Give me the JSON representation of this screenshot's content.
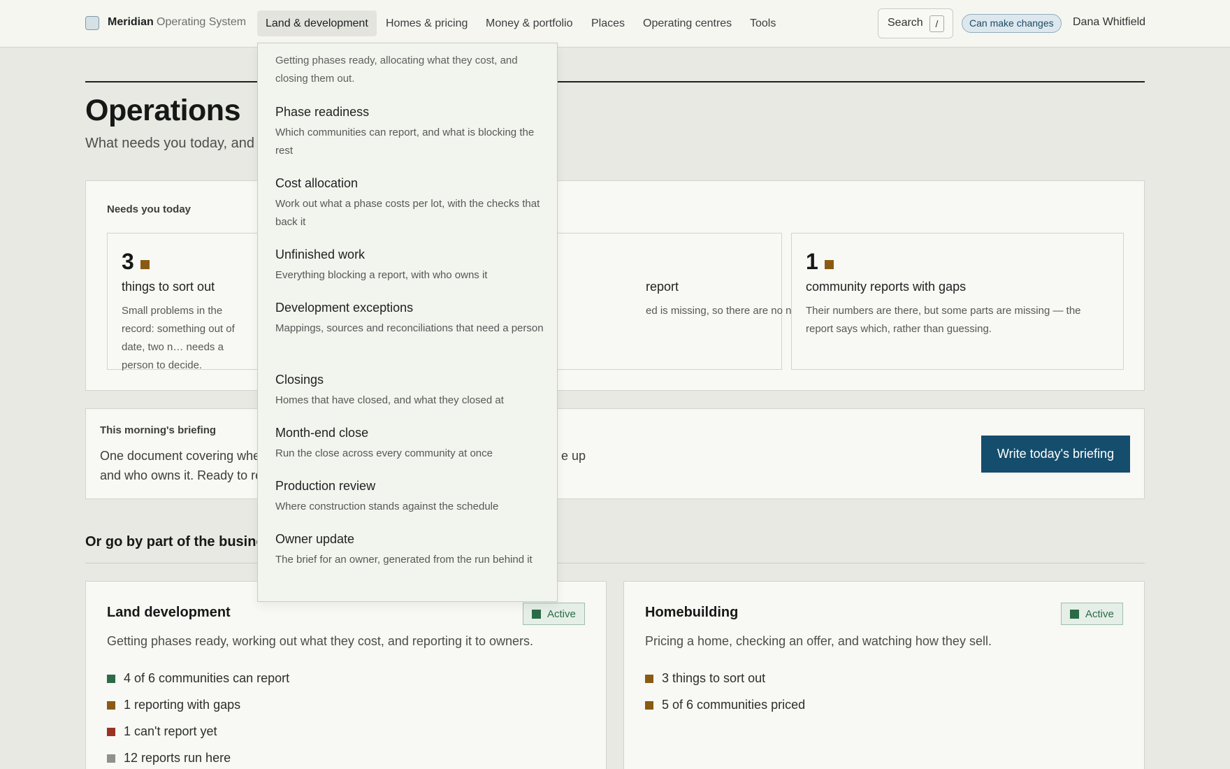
{
  "topbar": {
    "brand": "Meridian",
    "brand_sub": "Operating System",
    "nav": [
      {
        "label": "Land & development",
        "active": true
      },
      {
        "label": "Homes & pricing"
      },
      {
        "label": "Money & portfolio"
      },
      {
        "label": "Places"
      },
      {
        "label": "Operating centres"
      },
      {
        "label": "Tools"
      }
    ],
    "search_label": "Search",
    "search_shortcut": "/",
    "permission_badge": "Can make changes",
    "user_name": "Dana Whitfield"
  },
  "page": {
    "title": "Operations",
    "subtitle": "What needs you today, and"
  },
  "needs": {
    "label": "Needs you today",
    "cards": [
      {
        "count": "3",
        "title": "things to sort out",
        "desc": "Small problems in the record: something out of date, two n… needs a person to decide."
      },
      {
        "count": "",
        "title": "report",
        "desc": "ed is missing, so there are no numbers for"
      },
      {
        "count": "1",
        "title": "community reports with gaps",
        "desc": "Their numbers are there, but some parts are missing — the report says which, rather than guessing."
      }
    ]
  },
  "briefing": {
    "label": "This morning's briefing",
    "text_line1": "One document covering whe",
    "text_tail": "e up",
    "text_line2": "and who owns it. Ready to re",
    "button": "Write today's briefing"
  },
  "areas": {
    "section_title": "Or go by part of the busine",
    "cards": [
      {
        "title": "Land development",
        "desc": "Getting phases ready, working out what they cost, and reporting it to owners.",
        "status": "Active",
        "items": [
          {
            "text": "4 of 6 communities can report",
            "color": "#2c6b48"
          },
          {
            "text": "1 reporting with gaps",
            "color": "#8a5a14"
          },
          {
            "text": "1 can't report yet",
            "color": "#9a3324"
          },
          {
            "text": "12 reports run here",
            "color": "#8e918c"
          }
        ]
      },
      {
        "title": "Homebuilding",
        "desc": "Pricing a home, checking an offer, and watching how they sell.",
        "status": "Active",
        "items": [
          {
            "text": "3 things to sort out",
            "color": "#8a5a14"
          },
          {
            "text": "5 of 6 communities priced",
            "color": "#8a5a14"
          }
        ]
      }
    ]
  },
  "dropdown": {
    "intro": "Getting phases ready, allocating what they cost, and closing them out.",
    "items": [
      {
        "title": "Phase readiness",
        "desc": "Which communities can report, and what is blocking the rest"
      },
      {
        "title": "Cost allocation",
        "desc": "Work out what a phase costs per lot, with the checks that back it"
      },
      {
        "title": "Unfinished work",
        "desc": "Everything blocking a report, with who owns it"
      },
      {
        "title": "Development exceptions",
        "desc": "Mappings, sources and reconciliations that need a person"
      },
      {
        "title": "Closings",
        "desc": "Homes that have closed, and what they closed at"
      },
      {
        "title": "Month-end close",
        "desc": "Run the close across every community at once"
      },
      {
        "title": "Production review",
        "desc": "Where construction stands against the schedule"
      },
      {
        "title": "Owner update",
        "desc": "The brief for an owner, generated from the run behind it"
      }
    ]
  },
  "colors": {
    "accent": "#154d6c",
    "warning": "#8a5a14",
    "ok": "#2c6b48",
    "error": "#9a3324"
  }
}
